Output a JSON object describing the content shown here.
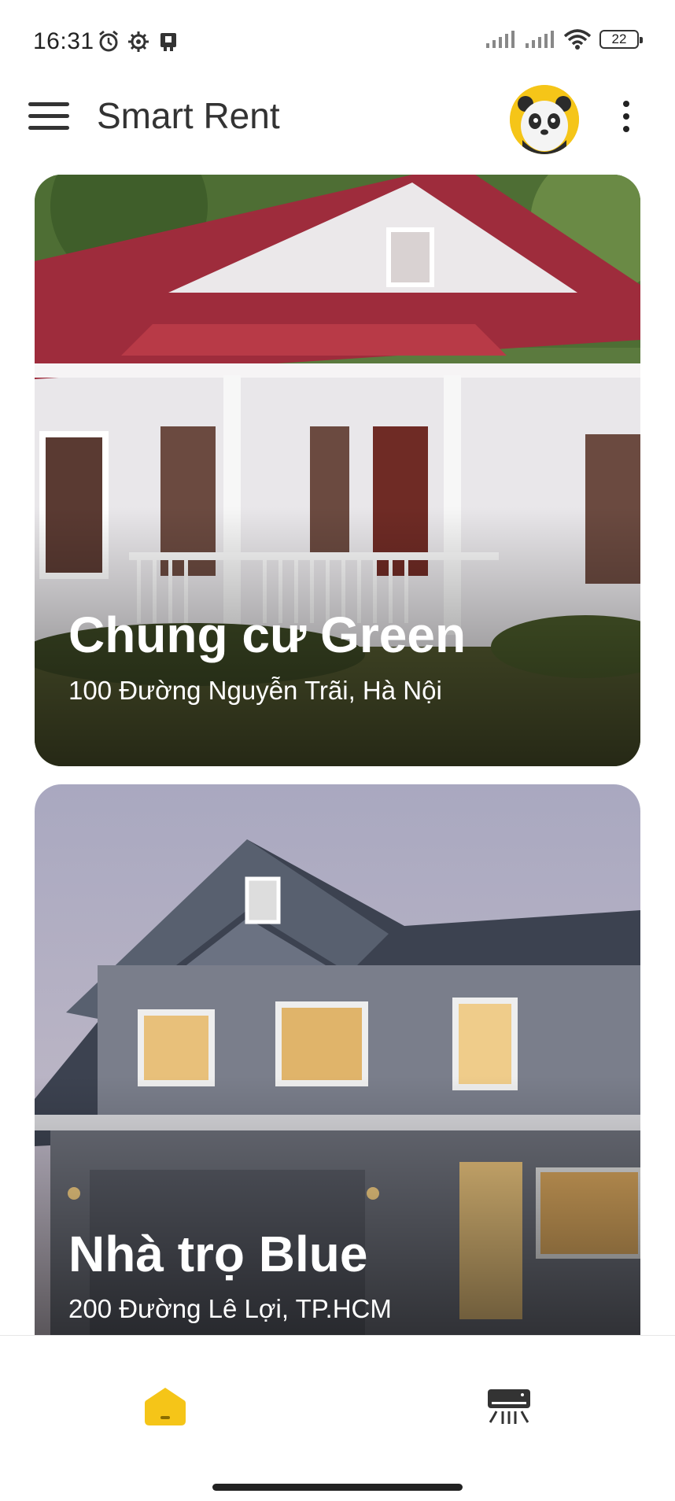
{
  "status_bar": {
    "time": "16:31",
    "left_icons": [
      "alarm-icon",
      "settings-icon",
      "notification-icon"
    ],
    "right_icons": [
      "signal-icon",
      "signal-icon",
      "wifi-icon"
    ],
    "battery": "22"
  },
  "app_bar": {
    "title": "Smart Rent",
    "menu_icon": "hamburger-menu-icon",
    "avatar_icon": "panda-avatar",
    "more_icon": "more-vertical-icon"
  },
  "properties": [
    {
      "name": "Chung cư Green",
      "address": "100 Đường Nguyễn Trãi, Hà Nội"
    },
    {
      "name": "Nhà trọ Blue",
      "address": "200 Đường Lê Lợi, TP.HCM"
    }
  ],
  "bottom_nav": {
    "items": [
      {
        "icon": "home-icon",
        "active": true
      },
      {
        "icon": "air-conditioner-icon",
        "active": false
      }
    ]
  },
  "colors": {
    "accent": "#F5C518",
    "text": "#333333",
    "card_text": "#FFFFFF"
  }
}
